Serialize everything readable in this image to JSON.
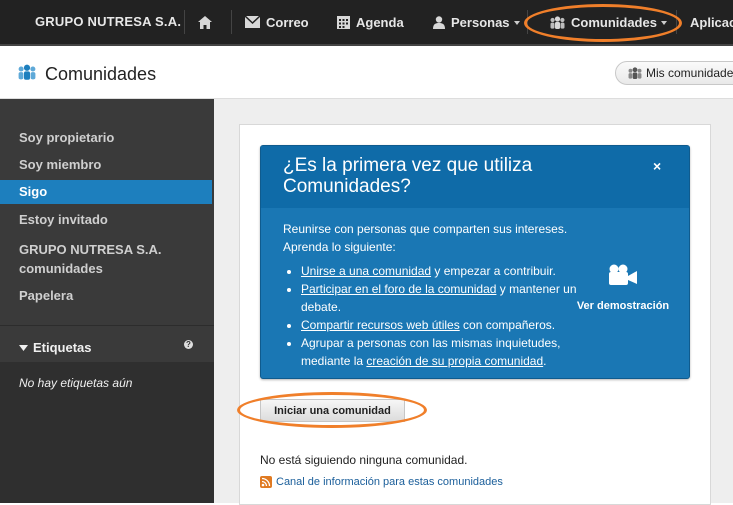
{
  "topnav": {
    "brand": "GRUPO NUTRESA S.A.",
    "items": [
      {
        "label": "Correo",
        "icon": "mail-icon"
      },
      {
        "label": "Agenda",
        "icon": "calendar-icon"
      },
      {
        "label": "Personas",
        "icon": "person-icon"
      },
      {
        "label": "Comunidades",
        "icon": "community-icon"
      },
      {
        "label": "Aplicac",
        "icon": ""
      }
    ]
  },
  "header": {
    "title": "Comunidades",
    "my_communities": "Mis comunidades"
  },
  "sidebar": {
    "items": [
      {
        "label": "Soy propietario"
      },
      {
        "label": "Soy miembro"
      },
      {
        "label": "Sigo"
      },
      {
        "label": "Estoy invitado"
      },
      {
        "label": "GRUPO NUTRESA S.A. comunidades"
      },
      {
        "label": "Papelera"
      }
    ],
    "tags_title": "Etiquetas",
    "tags_empty": "No hay etiquetas aún"
  },
  "intro": {
    "title": "¿Es la primera vez que utiliza Comunidades?",
    "close": "×",
    "lead1": "Reunirse con personas que comparten sus intereses.",
    "lead2": "Aprenda lo siguiente:",
    "bullets": [
      {
        "link": "Unirse a una comunidad",
        "rest": " y empezar a contribuir."
      },
      {
        "link": "Participar en el foro de la comunidad",
        "rest": " y mantener un debate."
      },
      {
        "link": "Compartir recursos web útiles",
        "rest": " con compañeros."
      },
      {
        "pre": "Agrupar a personas con las mismas inquietudes, mediante la ",
        "link": "creación de su propia comunidad",
        "rest": "."
      }
    ],
    "demo": "Ver demostración"
  },
  "content": {
    "start_button": "Iniciar una comunidad",
    "not_following": "No está siguiendo ninguna comunidad.",
    "rss_link": "Canal de información para estas comunidades"
  },
  "colors": {
    "nav_bg": "#222222",
    "accent": "#1d7fbe",
    "highlight": "#f07f2a"
  }
}
